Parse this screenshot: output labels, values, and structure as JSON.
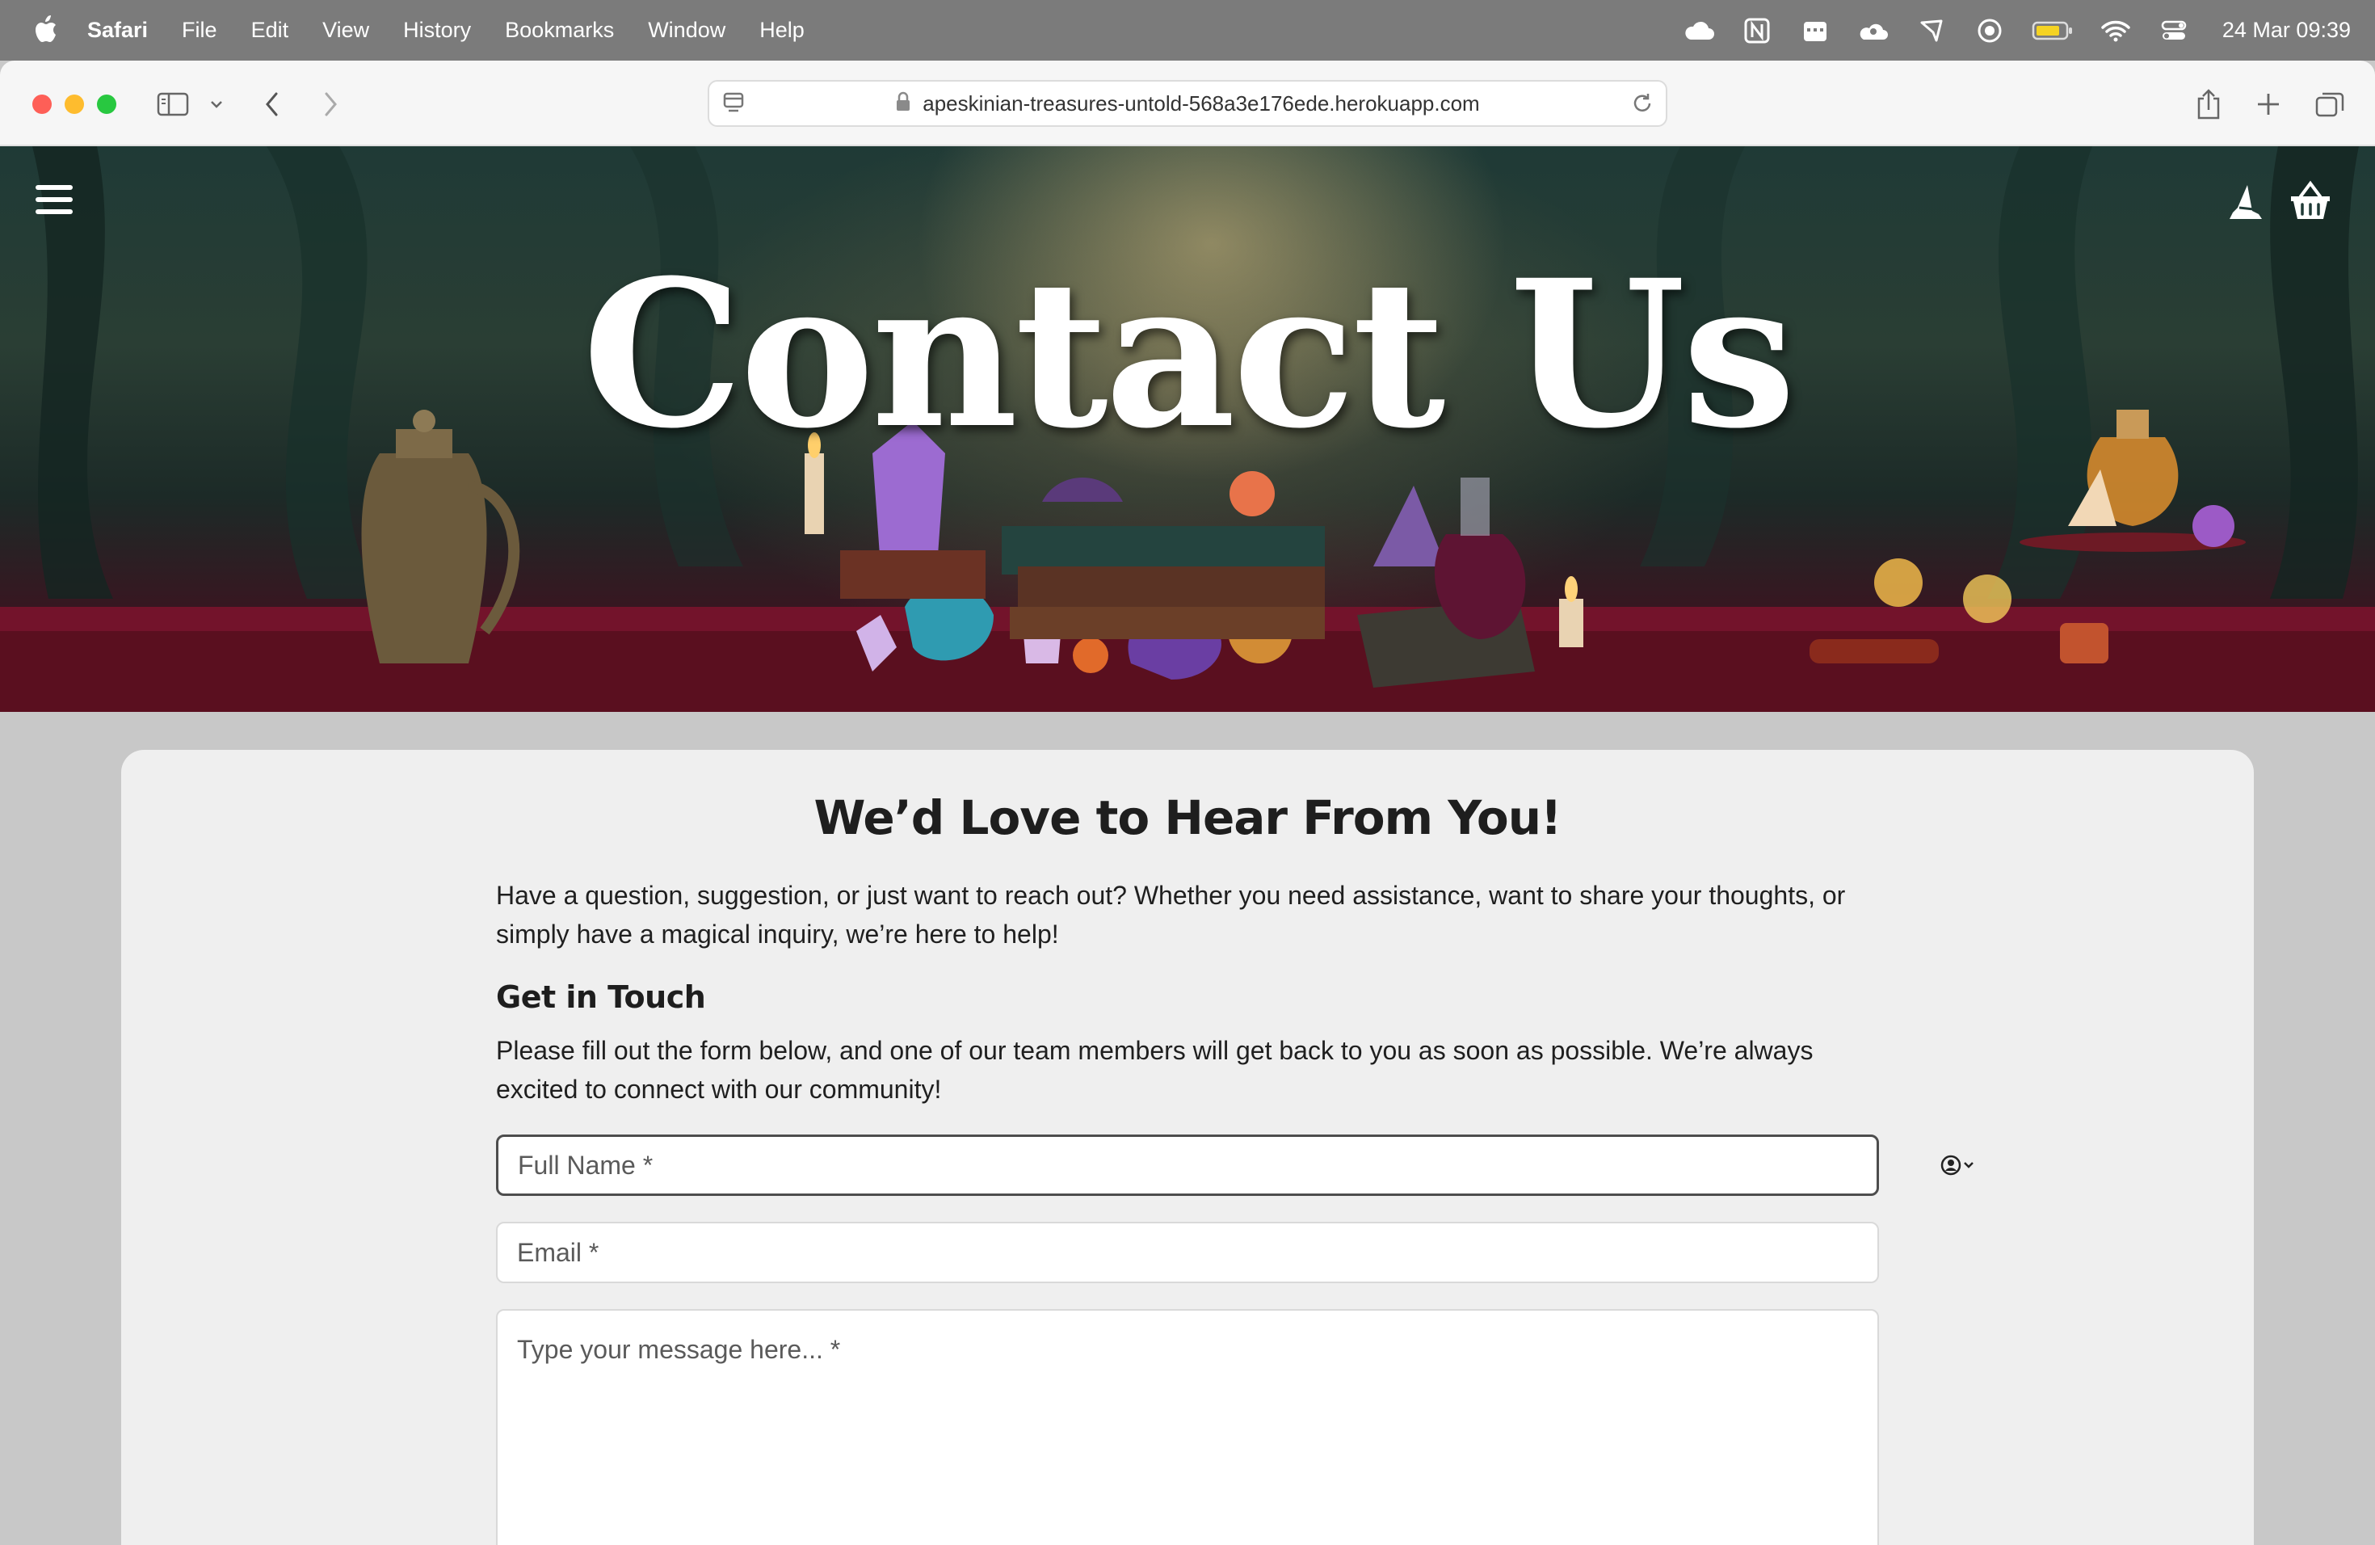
{
  "menubar": {
    "app": "Safari",
    "items": [
      "File",
      "Edit",
      "View",
      "History",
      "Bookmarks",
      "Window",
      "Help"
    ],
    "status_icons": [
      "cloud-icon",
      "notion-icon",
      "calendar-icon",
      "cloud-user-icon",
      "pointer-icon",
      "record-icon",
      "battery-icon",
      "wifi-icon",
      "control-center-icon"
    ],
    "clock": "24 Mar  09:39"
  },
  "browser": {
    "url": "apeskinian-treasures-untold-568a3e176ede.herokuapp.com"
  },
  "hero": {
    "title": "Contact Us"
  },
  "content": {
    "heading": "We’d Love to Hear From You!",
    "intro": "Have a question, suggestion, or just want to reach out? Whether you need assistance, want to share your thoughts, or simply have a magical inquiry, we’re here to help!",
    "subheading": "Get in Touch",
    "instructions": "Please fill out the form below, and one of our team members will get back to you as soon as possible. We’re always excited to connect with our community!"
  },
  "form": {
    "name_placeholder": "Full Name *",
    "email_placeholder": "Email *",
    "message_placeholder": "Type your message here... *"
  }
}
